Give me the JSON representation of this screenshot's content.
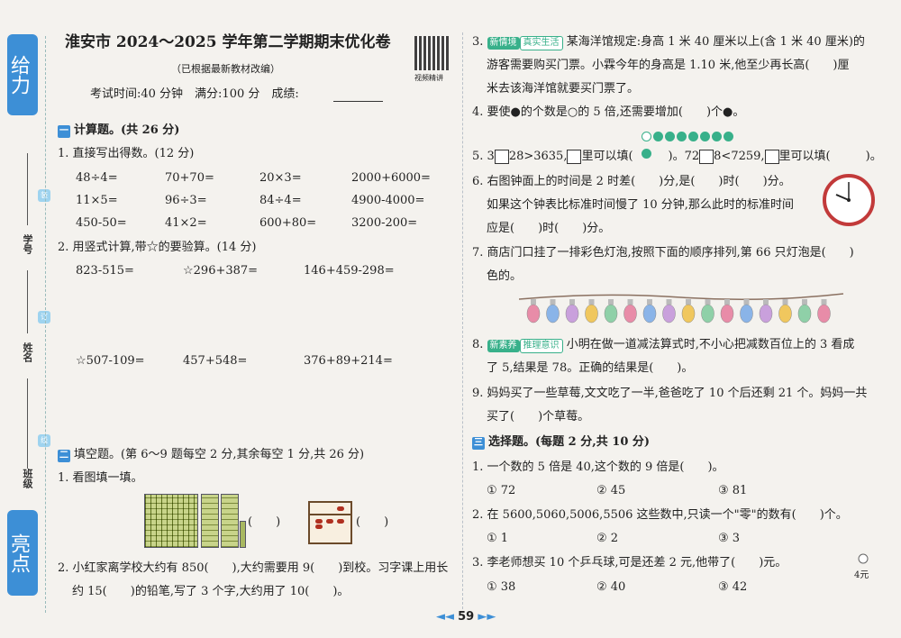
{
  "header": {
    "title": "淮安市 2024～2025 学年第二学期期末优化卷",
    "subtitle": "（已根据最新教材改编）",
    "qr_label": "视频精讲",
    "exam_info": "考试时间:40 分钟　满分:100 分　成绩:"
  },
  "sidebar": {
    "top_tab": "给力",
    "bottom_tab": "亮点",
    "labels": [
      "学号",
      "姓名",
      "班级"
    ],
    "dots": [
      "装",
      "订",
      "线"
    ]
  },
  "section1": {
    "badge": "一",
    "title": "计算题。(共 26 分)",
    "q1": {
      "label": "1. 直接写出得数。(12 分)",
      "rows": [
        [
          "48÷4=",
          "70+70=",
          "20×3=",
          "2000+6000="
        ],
        [
          "11×5=",
          "96÷3=",
          "84÷4=",
          "4900-4000="
        ],
        [
          "450-50=",
          "41×2=",
          "600+80=",
          "3200-200="
        ]
      ]
    },
    "q2": {
      "label": "2. 用竖式计算,带☆的要验算。(14 分)",
      "row1": [
        "823-515=",
        "☆296+387=",
        "146+459-298="
      ],
      "row2": [
        "☆507-109=",
        "457+548=",
        "376+89+214="
      ]
    }
  },
  "section2": {
    "badge": "二",
    "title": "填空题。(第 6～9 题每空 2 分,其余每空 1 分,共 26 分)",
    "q1": "1. 看图填一填。",
    "q1_blank": "(　　)",
    "q2_line1": "2. 小红家离学校大约有 850(　　),大约需要用 9(　　)到校。习字课上用长",
    "q2_line2": "约 15(　　)的铅笔,写了 3 个字,大约用了 10(　　)。"
  },
  "right": {
    "q3_line1_pre": "3.",
    "q3_tag1": "新情境",
    "q3_tag2": "真实生活",
    "q3_line1": "某海洋馆规定:身高 1 米 40 厘米以上(含 1 米 40 厘米)的",
    "q3_line2": "游客需要购买门票。小霖今年的身高是 1.10 米,他至少再长高(　　)厘",
    "q3_line3": "米去该海洋馆就要买门票了。",
    "q4": "4. 要使●的个数是○的 5 倍,还需要增加(　　)个●。",
    "q5_a": "5. 3",
    "q5_b": "28>3635,",
    "q5_c": "里可以填(　　　)。72",
    "q5_d": "8<7259,",
    "q5_e": "里可以填(　　　)。",
    "q6_line1": "6. 右图钟面上的时间是 2 时差(　　)分,是(　　)时(　　)分。",
    "q6_line2": "如果这个钟表比标准时间慢了 10 分钟,那么此时的标准时间",
    "q6_line3": "应是(　　)时(　　)分。",
    "q7_line1": "7. 商店门口挂了一排彩色灯泡,按照下面的顺序排列,第 66 只灯泡是(　　)",
    "q7_line2": "色的。",
    "q8_pre": "8.",
    "q8_tag1": "新素养",
    "q8_tag2": "推理意识",
    "q8_line1": "小明在做一道减法算式时,不小心把减数百位上的 3 看成",
    "q8_line2": "了 5,结果是 78。正确的结果是(　　)。",
    "q9_line1": "9. 妈妈买了一些草莓,文文吃了一半,爸爸吃了 10 个后还剩 21 个。妈妈一共",
    "q9_line2": "买了(　　)个草莓。"
  },
  "section3": {
    "badge": "三",
    "title": "选择题。(每题 2 分,共 10 分)",
    "q1": "1. 一个数的 5 倍是 40,这个数的 9 倍是(　　)。",
    "q1_opts": [
      "① 72",
      "② 45",
      "③ 81"
    ],
    "q2": "2. 在 5600,5060,5006,5506 这些数中,只读一个\"零\"的数有(　　)个。",
    "q2_opts": [
      "① 1",
      "② 2",
      "③ 3"
    ],
    "q3": "3. 李老师想买 10 个乒乓球,可是还差 2 元,他带了(　　)元。",
    "q3_price": "4元",
    "q3_opts": [
      "① 38",
      "② 40",
      "③ 42"
    ]
  },
  "footer": {
    "page": "59"
  },
  "colors": {
    "accent": "#3d8fd6",
    "green": "#38b08a"
  },
  "lights": [
    "#e88ca8",
    "#8ab4e8",
    "#c9a0dc",
    "#f0c75e",
    "#8fd0a8",
    "#e88ca8",
    "#8ab4e8",
    "#c9a0dc",
    "#f0c75e",
    "#8fd0a8",
    "#e88ca8",
    "#8ab4e8",
    "#c9a0dc",
    "#f0c75e",
    "#8fd0a8",
    "#e88ca8"
  ]
}
